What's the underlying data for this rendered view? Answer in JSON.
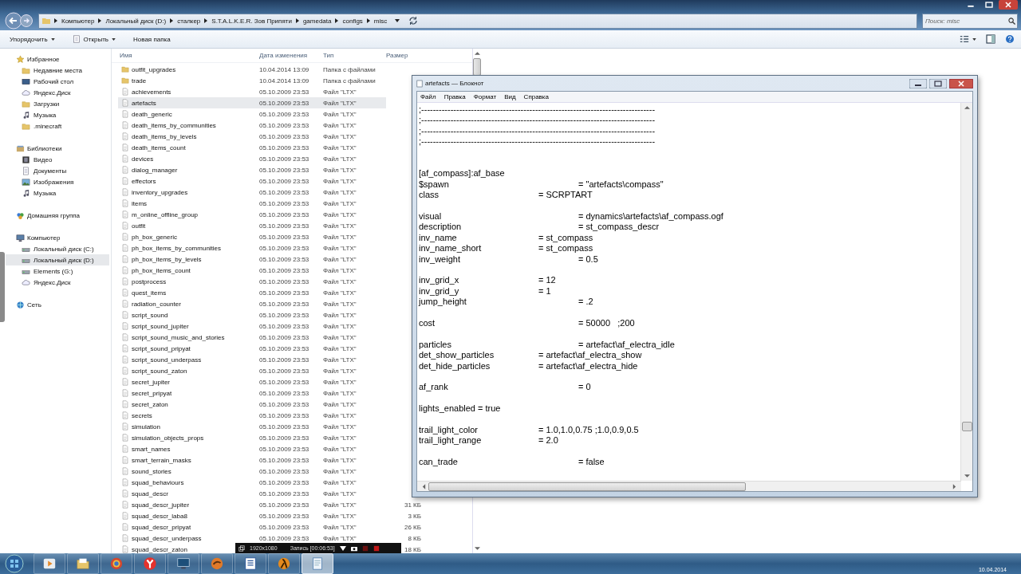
{
  "explorer": {
    "breadcrumb": [
      "Компьютер",
      "Локальный диск (D:)",
      "сталкер",
      "S.T.A.L.K.E.R. Зов Припяти",
      "gamedata",
      "configs",
      "misc"
    ],
    "search": {
      "placeholder": "Поиск: misc"
    },
    "toolbar": [
      {
        "label": "Упорядочить",
        "kind": "menu"
      },
      {
        "label": "Открыть",
        "kind": "open"
      },
      {
        "label": "Новая папка",
        "kind": "plain"
      }
    ],
    "nav": [
      {
        "label": "Избранное",
        "kind": "star",
        "children": [
          {
            "label": "Недавние места",
            "kind": "folder",
            "selected": false
          },
          {
            "label": "Рабочий стол",
            "kind": "desktop",
            "selected": false
          },
          {
            "label": "Яндекс.Диск",
            "kind": "cloud",
            "selected": false
          },
          {
            "label": "Загрузки",
            "kind": "folder",
            "selected": false
          },
          {
            "label": "Музыка",
            "kind": "music",
            "selected": false
          },
          {
            "label": ".minecraft",
            "kind": "folder",
            "selected": false
          }
        ]
      },
      {
        "label": "Библиотеки",
        "kind": "library",
        "children": [
          {
            "label": "Видео",
            "kind": "video",
            "selected": false
          },
          {
            "label": "Документы",
            "kind": "document",
            "selected": false
          },
          {
            "label": "Изображения",
            "kind": "image",
            "selected": false
          },
          {
            "label": "Музыка",
            "kind": "music",
            "selected": false
          }
        ]
      },
      {
        "label": "Домашняя группа",
        "kind": "homegroup"
      },
      {
        "label": "Компьютер",
        "kind": "computer",
        "children": [
          {
            "label": "Локальный диск (C:)",
            "kind": "drive",
            "selected": false
          },
          {
            "label": "Локальный диск (D:)",
            "kind": "drive",
            "selected": true
          },
          {
            "label": "Elements (G:)",
            "kind": "drive",
            "selected": false
          },
          {
            "label": "Яндекс.Диск",
            "kind": "cloud",
            "selected": false
          }
        ]
      },
      {
        "label": "Сеть",
        "kind": "network"
      }
    ],
    "columns": [
      "Имя",
      "Дата изменения",
      "Тип",
      "Размер"
    ],
    "files": [
      {
        "name": "outfit_upgrades",
        "kind": "folder",
        "date": "10.04.2014 13:09",
        "type": "Папка с файлами",
        "selected": false
      },
      {
        "name": "trade",
        "kind": "folder",
        "date": "10.04.2014 13:09",
        "type": "Папка с файлами",
        "selected": false
      },
      {
        "name": "achievements",
        "kind": "file",
        "date": "05.10.2009 23:53",
        "type": "Файл \"LTX\"",
        "selected": false
      },
      {
        "name": "artefacts",
        "kind": "file",
        "date": "05.10.2009 23:53",
        "type": "Файл \"LTX\"",
        "selected": true
      },
      {
        "name": "death_generic",
        "kind": "file",
        "date": "05.10.2009 23:53",
        "type": "Файл \"LTX\"",
        "selected": false
      },
      {
        "name": "death_items_by_communities",
        "kind": "file",
        "date": "05.10.2009 23:53",
        "type": "Файл \"LTX\"",
        "selected": false
      },
      {
        "name": "death_items_by_levels",
        "kind": "file",
        "date": "05.10.2009 23:53",
        "type": "Файл \"LTX\"",
        "selected": false
      },
      {
        "name": "death_items_count",
        "kind": "file",
        "date": "05.10.2009 23:53",
        "type": "Файл \"LTX\"",
        "selected": false
      },
      {
        "name": "devices",
        "kind": "file",
        "date": "05.10.2009 23:53",
        "type": "Файл \"LTX\"",
        "selected": false
      },
      {
        "name": "dialog_manager",
        "kind": "file",
        "date": "05.10.2009 23:53",
        "type": "Файл \"LTX\"",
        "selected": false
      },
      {
        "name": "effectors",
        "kind": "file",
        "date": "05.10.2009 23:53",
        "type": "Файл \"LTX\"",
        "selected": false
      },
      {
        "name": "inventory_upgrades",
        "kind": "file",
        "date": "05.10.2009 23:53",
        "type": "Файл \"LTX\"",
        "selected": false
      },
      {
        "name": "items",
        "kind": "file",
        "date": "05.10.2009 23:53",
        "type": "Файл \"LTX\"",
        "selected": false
      },
      {
        "name": "m_online_offline_group",
        "kind": "file",
        "date": "05.10.2009 23:53",
        "type": "Файл \"LTX\"",
        "selected": false
      },
      {
        "name": "outfit",
        "kind": "file",
        "date": "05.10.2009 23:53",
        "type": "Файл \"LTX\"",
        "selected": false
      },
      {
        "name": "ph_box_generic",
        "kind": "file",
        "date": "05.10.2009 23:53",
        "type": "Файл \"LTX\"",
        "selected": false
      },
      {
        "name": "ph_box_items_by_communities",
        "kind": "file",
        "date": "05.10.2009 23:53",
        "type": "Файл \"LTX\"",
        "selected": false
      },
      {
        "name": "ph_box_items_by_levels",
        "kind": "file",
        "date": "05.10.2009 23:53",
        "type": "Файл \"LTX\"",
        "selected": false
      },
      {
        "name": "ph_box_items_count",
        "kind": "file",
        "date": "05.10.2009 23:53",
        "type": "Файл \"LTX\"",
        "selected": false
      },
      {
        "name": "postprocess",
        "kind": "file",
        "date": "05.10.2009 23:53",
        "type": "Файл \"LTX\"",
        "selected": false
      },
      {
        "name": "quest_items",
        "kind": "file",
        "date": "05.10.2009 23:53",
        "type": "Файл \"LTX\"",
        "selected": false
      },
      {
        "name": "radiation_counter",
        "kind": "file",
        "date": "05.10.2009 23:53",
        "type": "Файл \"LTX\"",
        "selected": false
      },
      {
        "name": "script_sound",
        "kind": "file",
        "date": "05.10.2009 23:53",
        "type": "Файл \"LTX\"",
        "selected": false
      },
      {
        "name": "script_sound_jupiter",
        "kind": "file",
        "date": "05.10.2009 23:53",
        "type": "Файл \"LTX\"",
        "selected": false
      },
      {
        "name": "script_sound_music_and_stories",
        "kind": "file",
        "date": "05.10.2009 23:53",
        "type": "Файл \"LTX\"",
        "selected": false
      },
      {
        "name": "script_sound_pripyat",
        "kind": "file",
        "date": "05.10.2009 23:53",
        "type": "Файл \"LTX\"",
        "selected": false
      },
      {
        "name": "script_sound_underpass",
        "kind": "file",
        "date": "05.10.2009 23:53",
        "type": "Файл \"LTX\"",
        "selected": false
      },
      {
        "name": "script_sound_zaton",
        "kind": "file",
        "date": "05.10.2009 23:53",
        "type": "Файл \"LTX\"",
        "selected": false
      },
      {
        "name": "secret_jupiter",
        "kind": "file",
        "date": "05.10.2009 23:53",
        "type": "Файл \"LTX\"",
        "selected": false
      },
      {
        "name": "secret_pripyat",
        "kind": "file",
        "date": "05.10.2009 23:53",
        "type": "Файл \"LTX\"",
        "selected": false
      },
      {
        "name": "secret_zaton",
        "kind": "file",
        "date": "05.10.2009 23:53",
        "type": "Файл \"LTX\"",
        "selected": false
      },
      {
        "name": "secrets",
        "kind": "file",
        "date": "05.10.2009 23:53",
        "type": "Файл \"LTX\"",
        "selected": false
      },
      {
        "name": "simulation",
        "kind": "file",
        "date": "05.10.2009 23:53",
        "type": "Файл \"LTX\"",
        "selected": false
      },
      {
        "name": "simulation_objects_props",
        "kind": "file",
        "date": "05.10.2009 23:53",
        "type": "Файл \"LTX\"",
        "selected": false
      },
      {
        "name": "smart_names",
        "kind": "file",
        "date": "05.10.2009 23:53",
        "type": "Файл \"LTX\"",
        "selected": false
      },
      {
        "name": "smart_terrain_masks",
        "kind": "file",
        "date": "05.10.2009 23:53",
        "type": "Файл \"LTX\"",
        "selected": false
      },
      {
        "name": "sound_stories",
        "kind": "file",
        "date": "05.10.2009 23:53",
        "type": "Файл \"LTX\"",
        "selected": false
      },
      {
        "name": "squad_behaviours",
        "kind": "file",
        "date": "05.10.2009 23:53",
        "type": "Файл \"LTX\"",
        "selected": false
      },
      {
        "name": "squad_descr",
        "kind": "file",
        "date": "05.10.2009 23:53",
        "type": "Файл \"LTX\"",
        "selected": false
      },
      {
        "name": "squad_descr_jupiter",
        "kind": "file",
        "date": "05.10.2009 23:53",
        "type": "Файл \"LTX\"",
        "size": "31 КБ",
        "selected": false
      },
      {
        "name": "squad_descr_laba8",
        "kind": "file",
        "date": "05.10.2009 23:53",
        "type": "Файл \"LTX\"",
        "size": "3 КБ",
        "selected": false
      },
      {
        "name": "squad_descr_pripyat",
        "kind": "file",
        "date": "05.10.2009 23:53",
        "type": "Файл \"LTX\"",
        "size": "26 КБ",
        "selected": false
      },
      {
        "name": "squad_descr_underpass",
        "kind": "file",
        "date": "05.10.2009 23:53",
        "type": "Файл \"LTX\"",
        "size": "8 КБ",
        "selected": false
      },
      {
        "name": "squad_descr_zaton",
        "kind": "file",
        "size": "18 КБ",
        "selected": false
      }
    ]
  },
  "notepad": {
    "title": "artefacts — Блокнот",
    "menu": [
      "Файл",
      "Правка",
      "Формат",
      "Вид",
      "Справка"
    ],
    "comment_lines": [
      ";--------------------------------------------------------------------------------",
      ";--------------------------------------------------------------------------------",
      ";--------------------------------------------------------------------------------",
      ";--------------------------------------------------------------------------------"
    ],
    "blocks": [
      [
        "[af_compass]:af_base",
        "$spawn\t\t\t\t= \"artefacts\\compass\"",
        "class\t\t\t= SCRPTART"
      ],
      [
        "visual\t\t\t\t= dynamics\\artefacts\\af_compass.ogf",
        "description\t\t\t= st_compass_descr",
        "inv_name\t\t\t= st_compass",
        "inv_name_short\t\t= st_compass",
        "inv_weight\t\t\t= 0.5"
      ],
      [
        "inv_grid_x\t\t= 12",
        "inv_grid_y\t\t= 1",
        "jump_height\t\t\t= .2"
      ],
      [
        "cost\t\t\t\t= 50000   ;200"
      ],
      [
        "particles\t\t\t\t= artefact\\af_electra_idle",
        "det_show_particles\t\t= artefact\\af_electra_show",
        "det_hide_particles\t\t= artefact\\af_electra_hide"
      ],
      [
        "af_rank\t\t\t\t= 0"
      ],
      [
        "lights_enabled = true"
      ],
      [
        "trail_light_color\t\t= 1.0,1.0,0.75 ;1.0,0.9,0.5",
        "trail_light_range\t\t= 2.0"
      ],
      [
        "can_trade\t\t\t= false"
      ]
    ]
  },
  "recorder": {
    "resolution": "1920x1080",
    "status": "Запись [00:06:53]"
  },
  "taskbar": {
    "apps": [
      {
        "kind": "player",
        "selected": false
      },
      {
        "kind": "folders",
        "selected": false
      },
      {
        "kind": "ring",
        "selected": false
      },
      {
        "kind": "redlogo",
        "selected": false
      },
      {
        "kind": "monitor",
        "selected": false
      },
      {
        "kind": "orange",
        "selected": false
      },
      {
        "kind": "document",
        "selected": false
      },
      {
        "kind": "lambda",
        "selected": false
      },
      {
        "kind": "notepad",
        "selected": true
      }
    ],
    "date": "10.04.2014"
  }
}
